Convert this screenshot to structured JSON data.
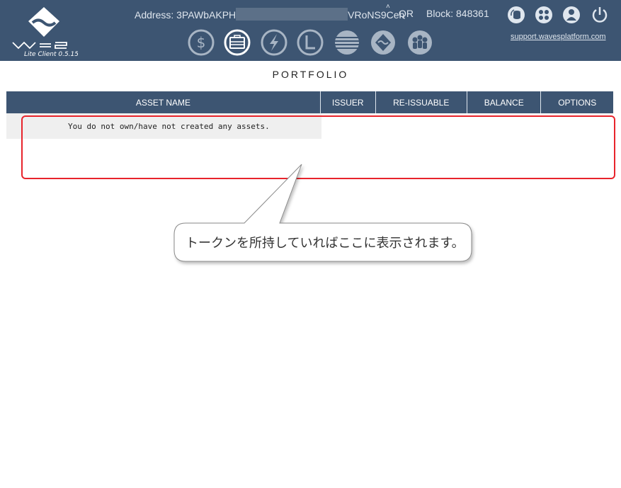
{
  "header": {
    "logo_subtitle": "Lite Client 0.5.15a",
    "address_prefix": "Address: 3PAWbAKPH",
    "address_suffix": "VRoNS9Ceh",
    "qr_label": "QR",
    "block_label": "Block: 848361",
    "support_link": "support.wavesplatform.com",
    "top_icons": [
      "refresh-database-icon",
      "community-icon",
      "account-icon",
      "power-icon"
    ],
    "nav_icons": [
      "wallet-dollar-icon",
      "portfolio-icon",
      "exchange-icon",
      "leasing-icon",
      "history-icon",
      "dex-icon",
      "community-group-icon"
    ],
    "active_nav": "portfolio-icon"
  },
  "page": {
    "title": "PORTFOLIO"
  },
  "table": {
    "columns": [
      "ASSET NAME",
      "ISSUER",
      "RE-ISSUABLE",
      "BALANCE",
      "OPTIONS"
    ],
    "empty_message": "You do not own/have not created any assets."
  },
  "annotation": {
    "callout_text": "トークンを所持していればここに表示されます。"
  },
  "colors": {
    "header_bg": "#3d5572",
    "highlight_border": "#e8242c"
  }
}
